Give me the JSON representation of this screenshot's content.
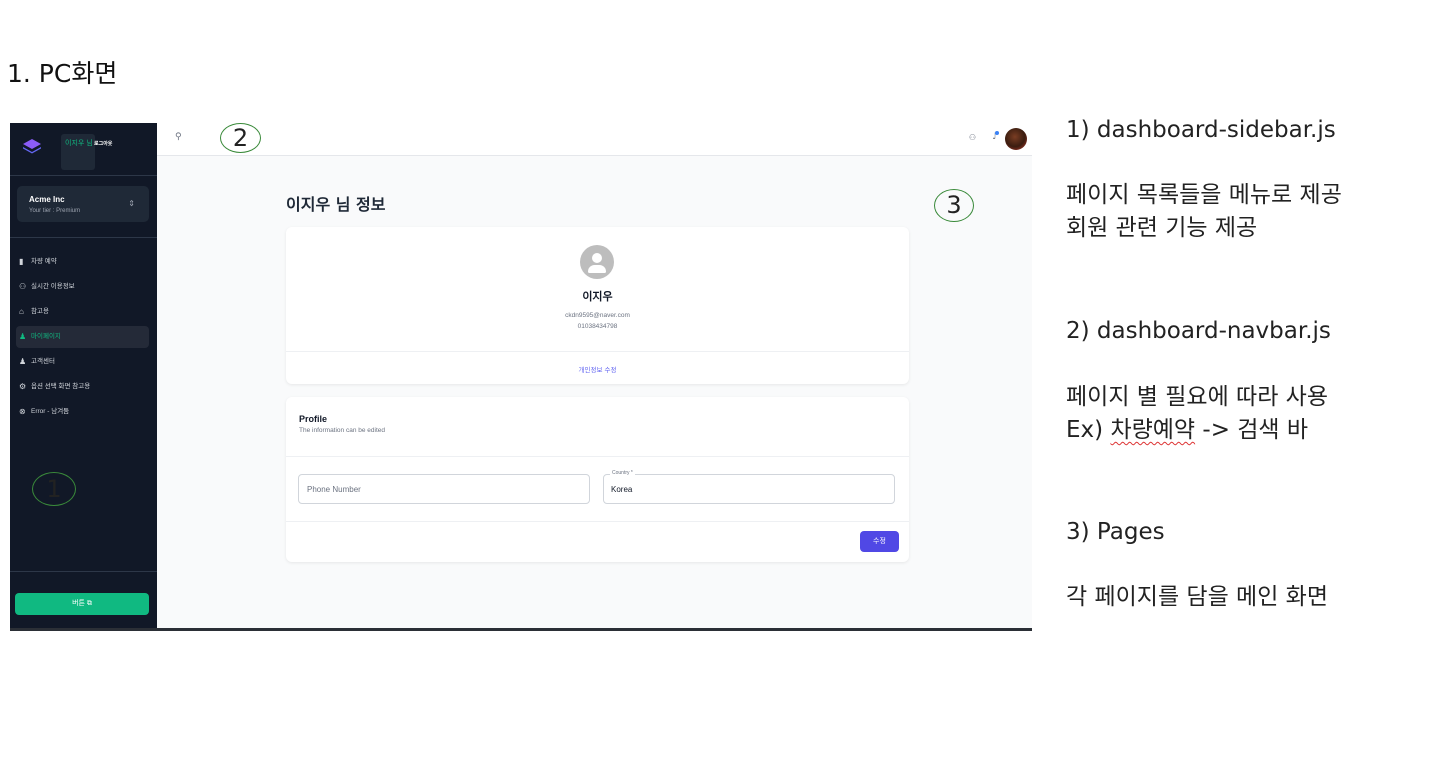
{
  "heading": "1. PC화면",
  "sidebar": {
    "user_name": "이지우 님",
    "logout_label": "로그아웃",
    "org": {
      "name": "Acme Inc",
      "tier": "Your tier : Premium"
    },
    "items": [
      {
        "icon": "chart-bar-icon",
        "label": "차량 예약"
      },
      {
        "icon": "users-icon",
        "label": "실시간 이용정보"
      },
      {
        "icon": "garage-icon",
        "label": "참고용"
      },
      {
        "icon": "user-icon",
        "label": "마이페이지",
        "active": true
      },
      {
        "icon": "user-icon",
        "label": "고객센터"
      },
      {
        "icon": "gear-icon",
        "label": "옵션 선택 화면 참고용"
      },
      {
        "icon": "error-icon",
        "label": "Error - 남겨둠"
      }
    ],
    "button_label": "버튼 ⧉"
  },
  "navbar": {
    "icons": [
      "search-icon",
      "users-icon",
      "bell-icon",
      "avatar"
    ]
  },
  "main": {
    "title": "이지우 님 정보",
    "profile": {
      "name": "이지우",
      "email": "ckdn9595@naver.com",
      "phone": "01038434798",
      "edit_label": "개인정보 수정"
    },
    "form": {
      "title": "Profile",
      "subtitle": "The information can be edited",
      "phone_placeholder": "Phone Number",
      "country_label": "Country *",
      "country_value": "Korea",
      "submit_label": "수정"
    }
  },
  "callouts": [
    "1",
    "2",
    "3"
  ],
  "notes": {
    "n1_title": "1)  dashboard-sidebar.js",
    "n1_line1": "페이지 목록들을 메뉴로 제공",
    "n1_line2": "회원 관련 기능 제공",
    "n2_title": "2) dashboard-navbar.js",
    "n2_line1": "페이지 별 필요에 따라 사용",
    "n2_line2_prefix": "Ex) ",
    "n2_line2_underlined": "차량예약",
    "n2_line2_suffix": " -> 검색 바",
    "n3_title": "3) Pages",
    "n3_line1": "각 페이지를 담을 메인 화면"
  },
  "colors": {
    "sidebar_bg": "#111827",
    "accent_green": "#10b981",
    "primary_purple": "#5048e5",
    "callout_border": "#3a8a3a"
  }
}
